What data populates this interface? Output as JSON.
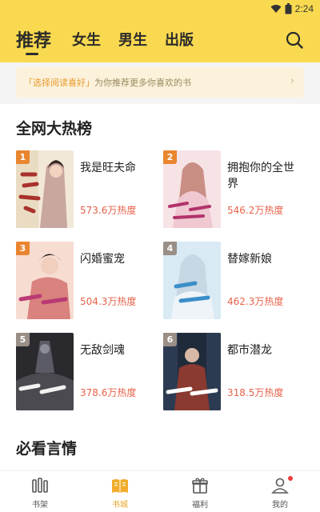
{
  "status": {
    "time": "2:24"
  },
  "topnav": {
    "tabs": [
      {
        "label": "推荐",
        "active": true
      },
      {
        "label": "女生",
        "active": false
      },
      {
        "label": "男生",
        "active": false
      },
      {
        "label": "出版",
        "active": false
      }
    ],
    "search_icon": "search-icon"
  },
  "banner": {
    "highlight": "「选择阅读喜好」",
    "text": "为你推荐更多你喜欢的书",
    "arrow": "›"
  },
  "hot": {
    "title": "全网大热榜",
    "items": [
      {
        "rank": "1",
        "title": "我是旺夫命",
        "heat": "573.6万热度",
        "badge_color": "#e9852f"
      },
      {
        "rank": "2",
        "title": "拥抱你的全世界",
        "heat": "546.2万热度",
        "badge_color": "#e9852f"
      },
      {
        "rank": "3",
        "title": "闪婚蜜宠",
        "heat": "504.3万热度",
        "badge_color": "#e9852f"
      },
      {
        "rank": "4",
        "title": "替嫁新娘",
        "heat": "462.3万热度",
        "badge_color": "#9a8f86"
      },
      {
        "rank": "5",
        "title": "无敌剑魂",
        "heat": "378.6万热度",
        "badge_color": "#9a8f86"
      },
      {
        "rank": "6",
        "title": "都市潜龙",
        "heat": "318.5万热度",
        "badge_color": "#9a8f86"
      }
    ]
  },
  "section2": {
    "title": "必看言情"
  },
  "bottomnav": {
    "items": [
      {
        "label": "书架",
        "icon": "bookshelf-icon",
        "active": false
      },
      {
        "label": "书城",
        "icon": "book-city-icon",
        "active": true
      },
      {
        "label": "福利",
        "icon": "gift-icon",
        "active": false
      },
      {
        "label": "我的",
        "icon": "profile-icon",
        "active": false,
        "badge": true
      }
    ]
  },
  "colors": {
    "brand": "#f9d94f",
    "heat": "#e8624a",
    "active_tab": "#e8a628"
  }
}
